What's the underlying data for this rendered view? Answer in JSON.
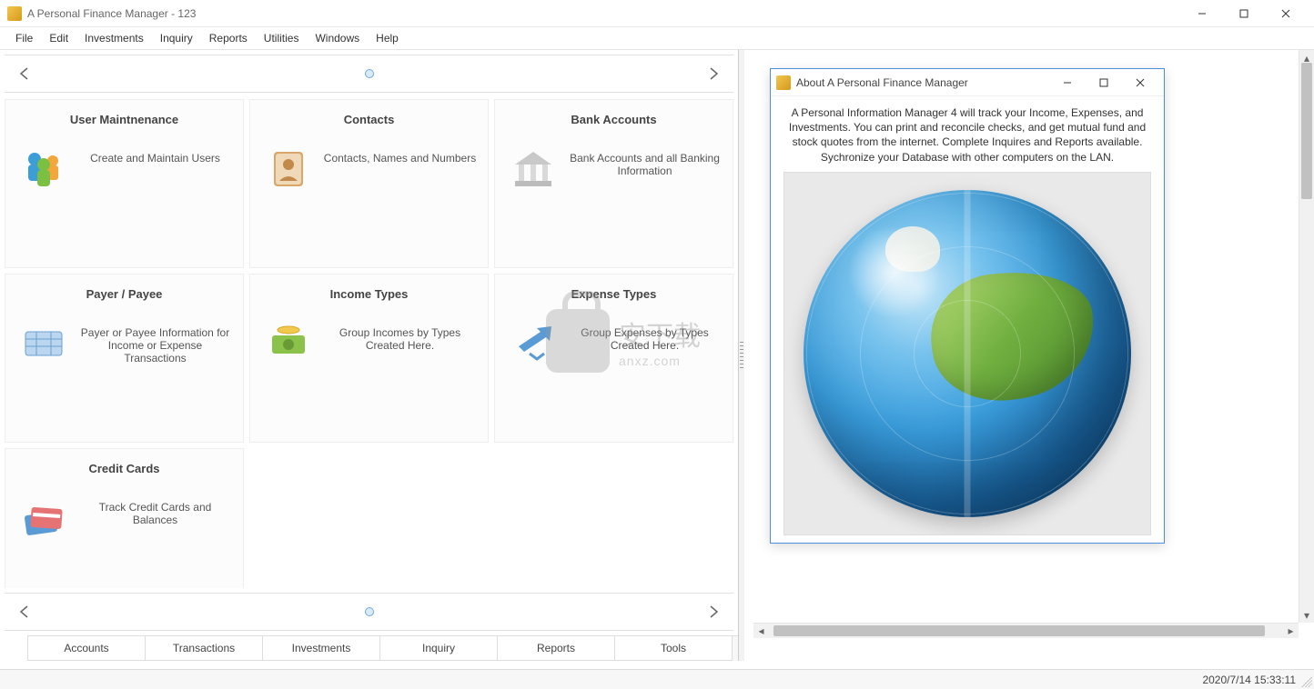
{
  "window": {
    "title": "A Personal Finance Manager - 123"
  },
  "menu": [
    "File",
    "Edit",
    "Investments",
    "Inquiry",
    "Reports",
    "Utilities",
    "Windows",
    "Help"
  ],
  "tiles": [
    {
      "title": "User Maintnenance",
      "desc": "Create and Maintain Users",
      "icon": "users-icon"
    },
    {
      "title": "Contacts",
      "desc": "Contacts, Names and Numbers",
      "icon": "contacts-icon"
    },
    {
      "title": "Bank Accounts",
      "desc": "Bank Accounts and all Banking Information",
      "icon": "bank-icon"
    },
    {
      "title": "Payer / Payee",
      "desc": "Payer or Payee Information for Income or Expense Transactions",
      "icon": "payee-icon"
    },
    {
      "title": "Income Types",
      "desc": "Group Incomes by Types Created Here.",
      "icon": "income-icon"
    },
    {
      "title": "Expense Types",
      "desc": "Group Expenses by Types Created Here.",
      "icon": "expense-icon"
    },
    {
      "title": "Credit Cards",
      "desc": "Track Credit Cards and Balances",
      "icon": "credit-cards-icon"
    }
  ],
  "bottom_tabs": [
    "Accounts",
    "Transactions",
    "Investments",
    "Inquiry",
    "Reports",
    "Tools"
  ],
  "about": {
    "title": "About A Personal Finance Manager",
    "text": "A Personal Information Manager 4 will track your Income, Expenses, and Investments. You can print and reconcile checks, and get mutual fund and stock quotes from the internet. Complete Inquires and Reports available. Sychronize your Database with other computers on the LAN."
  },
  "status": {
    "timestamp": "2020/7/14 15:33:11"
  },
  "watermark": {
    "cn": "安下载",
    "en": "anxz.com"
  }
}
